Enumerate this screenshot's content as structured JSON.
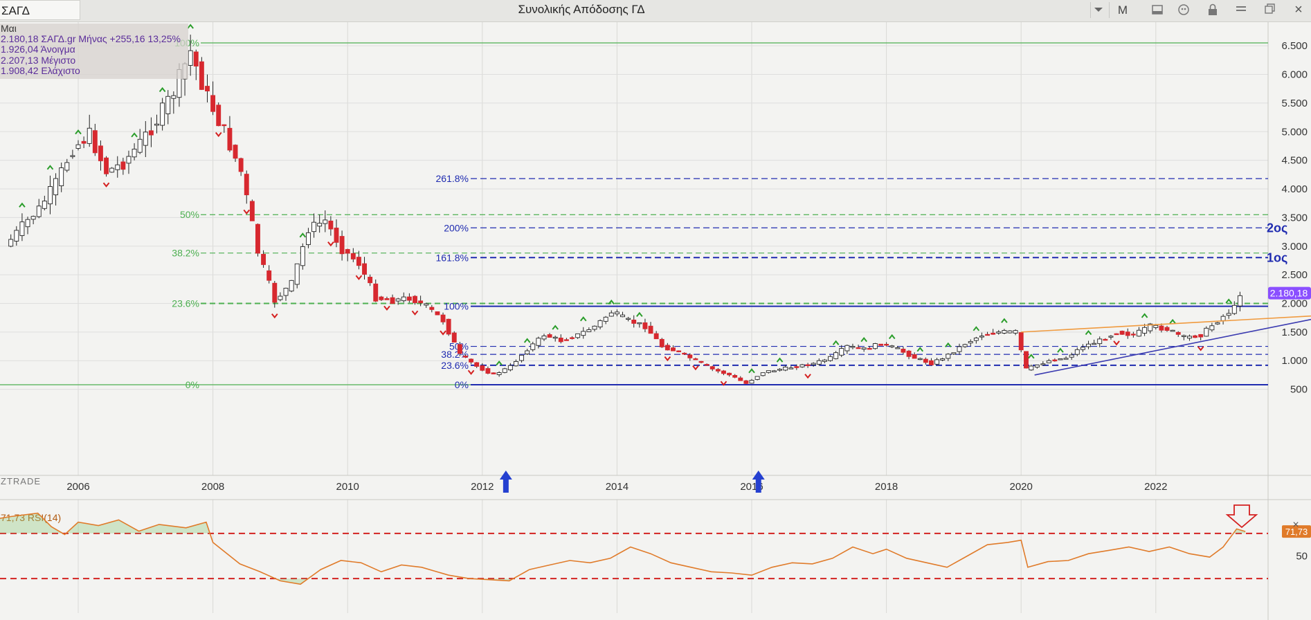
{
  "toolbar": {
    "symbol": "ΣΑΓΔ",
    "title": "Συνολικής Απόδοσης ΓΔ",
    "period": "M",
    "icons": [
      "chevron-down-icon",
      "layout-icon",
      "quote-icon",
      "lock-icon",
      "menu-icon",
      "restore-icon",
      "close-icon"
    ],
    "close_label": "×"
  },
  "info": {
    "period_label": "Μαι",
    "close_line": "2.180,18 ΣΑΓΔ.gr Μήνας +255,16 13,25%",
    "open_line": "1.926,04 Άνοιγμα",
    "high_line": "2.207,13 Μέγιστο",
    "low_line": "1.908,42 Ελάχιστο"
  },
  "watermark": "ZTRADE",
  "colors": {
    "up_candle": "#ffffff",
    "down_candle": "#d7282f",
    "fib_old": "#4caf50",
    "fib_new": "#1f2bb0",
    "rsi_line": "#e07b2a",
    "rsi_bound": "#d42020",
    "trend_orange": "#f09a3e",
    "trend_blue": "#3a3ab0",
    "last_price": "#8a4fff"
  },
  "annotations": {
    "target_2": "2ος",
    "target_1": "1ος"
  },
  "chart_data": [
    {
      "type": "candlestick",
      "period": "monthly",
      "x_ticks": [
        "2006",
        "2008",
        "2010",
        "2012",
        "2014",
        "2016",
        "2018",
        "2020",
        "2022"
      ],
      "y_ticks": [
        "6.500",
        "6.000",
        "5.500",
        "5.000",
        "4.500",
        "4.000",
        "3.500",
        "3.000",
        "2.500",
        "2.000",
        "1.500",
        "1.000",
        "500"
      ],
      "ylim": [
        430,
        6950
      ],
      "last_price_label": "2.180,18",
      "last_price": 2180.18,
      "series_approx_close": [
        [
          2005.0,
          3000
        ],
        [
          2005.25,
          3350
        ],
        [
          2005.5,
          3650
        ],
        [
          2005.75,
          4100
        ],
        [
          2006.0,
          4700
        ],
        [
          2006.25,
          4950
        ],
        [
          2006.5,
          4300
        ],
        [
          2006.75,
          4450
        ],
        [
          2007.0,
          4800
        ],
        [
          2007.25,
          5200
        ],
        [
          2007.5,
          5700
        ],
        [
          2007.75,
          6400
        ],
        [
          2008.0,
          5600
        ],
        [
          2008.25,
          5000
        ],
        [
          2008.5,
          4300
        ],
        [
          2008.75,
          2900
        ],
        [
          2009.0,
          2050
        ],
        [
          2009.25,
          2350
        ],
        [
          2009.5,
          3300
        ],
        [
          2009.75,
          3450
        ],
        [
          2010.0,
          2950
        ],
        [
          2010.25,
          2700
        ],
        [
          2010.5,
          2100
        ],
        [
          2010.75,
          2050
        ],
        [
          2011.0,
          2100
        ],
        [
          2011.25,
          1950
        ],
        [
          2011.5,
          1700
        ],
        [
          2011.75,
          1100
        ],
        [
          2012.0,
          900
        ],
        [
          2012.25,
          750
        ],
        [
          2012.5,
          900
        ],
        [
          2012.75,
          1200
        ],
        [
          2013.0,
          1450
        ],
        [
          2013.25,
          1350
        ],
        [
          2013.5,
          1450
        ],
        [
          2013.75,
          1600
        ],
        [
          2014.0,
          1850
        ],
        [
          2014.25,
          1700
        ],
        [
          2014.5,
          1600
        ],
        [
          2014.75,
          1250
        ],
        [
          2015.0,
          1150
        ],
        [
          2015.25,
          1000
        ],
        [
          2015.5,
          850
        ],
        [
          2015.75,
          750
        ],
        [
          2016.0,
          600
        ],
        [
          2016.25,
          800
        ],
        [
          2016.5,
          850
        ],
        [
          2016.75,
          900
        ],
        [
          2017.0,
          950
        ],
        [
          2017.25,
          1050
        ],
        [
          2017.5,
          1250
        ],
        [
          2017.75,
          1200
        ],
        [
          2018.0,
          1300
        ],
        [
          2018.25,
          1200
        ],
        [
          2018.5,
          1050
        ],
        [
          2018.75,
          950
        ],
        [
          2019.0,
          1100
        ],
        [
          2019.25,
          1300
        ],
        [
          2019.5,
          1450
        ],
        [
          2019.75,
          1500
        ],
        [
          2020.0,
          1500
        ],
        [
          2020.15,
          850
        ],
        [
          2020.5,
          1000
        ],
        [
          2020.75,
          1050
        ],
        [
          2021.0,
          1250
        ],
        [
          2021.25,
          1350
        ],
        [
          2021.5,
          1500
        ],
        [
          2021.75,
          1450
        ],
        [
          2022.0,
          1600
        ],
        [
          2022.25,
          1550
        ],
        [
          2022.5,
          1400
        ],
        [
          2022.75,
          1450
        ],
        [
          2023.0,
          1700
        ],
        [
          2023.25,
          1926
        ],
        [
          2023.33,
          2180
        ]
      ],
      "fibonacci_2007_2012": [
        {
          "label": "100%",
          "value": 6550
        },
        {
          "label": "50%",
          "value": 3550
        },
        {
          "label": "38.2%",
          "value": 2880
        },
        {
          "label": "23.6%",
          "value": 2000
        },
        {
          "label": "0%",
          "value": 580
        }
      ],
      "fibonacci_2014_2016": [
        {
          "label": "261.8%",
          "value": 4180
        },
        {
          "label": "200%",
          "value": 3320
        },
        {
          "label": "161.8%",
          "value": 2800
        },
        {
          "label": "100%",
          "value": 1950
        },
        {
          "label": "50%",
          "value": 1250
        },
        {
          "label": "38.2%",
          "value": 1110
        },
        {
          "label": "23.6%",
          "value": 920
        },
        {
          "label": "0%",
          "value": 580
        }
      ]
    },
    {
      "type": "line",
      "name": "71,73 RSI(14)",
      "value_label": "71,73",
      "y_ticks": [
        "50"
      ],
      "bounds": [
        70,
        30
      ],
      "series": [
        [
          2004.0,
          72
        ],
        [
          2004.5,
          80
        ],
        [
          2005.0,
          85
        ],
        [
          2005.4,
          88
        ],
        [
          2005.6,
          76
        ],
        [
          2005.8,
          69
        ],
        [
          2006.0,
          80
        ],
        [
          2006.3,
          77
        ],
        [
          2006.6,
          82
        ],
        [
          2006.9,
          72
        ],
        [
          2007.2,
          78
        ],
        [
          2007.6,
          75
        ],
        [
          2007.9,
          80
        ],
        [
          2008.0,
          62
        ],
        [
          2008.4,
          43
        ],
        [
          2008.7,
          36
        ],
        [
          2009.0,
          28
        ],
        [
          2009.3,
          25
        ],
        [
          2009.6,
          38
        ],
        [
          2009.9,
          46
        ],
        [
          2010.2,
          44
        ],
        [
          2010.5,
          36
        ],
        [
          2010.8,
          42
        ],
        [
          2011.1,
          40
        ],
        [
          2011.5,
          33
        ],
        [
          2011.8,
          30
        ],
        [
          2012.1,
          29
        ],
        [
          2012.4,
          28
        ],
        [
          2012.7,
          38
        ],
        [
          2013.0,
          42
        ],
        [
          2013.3,
          46
        ],
        [
          2013.6,
          44
        ],
        [
          2013.9,
          48
        ],
        [
          2014.2,
          58
        ],
        [
          2014.5,
          52
        ],
        [
          2014.8,
          44
        ],
        [
          2015.1,
          40
        ],
        [
          2015.4,
          36
        ],
        [
          2015.7,
          35
        ],
        [
          2016.0,
          33
        ],
        [
          2016.3,
          40
        ],
        [
          2016.6,
          44
        ],
        [
          2016.9,
          43
        ],
        [
          2017.2,
          48
        ],
        [
          2017.5,
          58
        ],
        [
          2017.8,
          52
        ],
        [
          2018.0,
          56
        ],
        [
          2018.3,
          48
        ],
        [
          2018.6,
          44
        ],
        [
          2018.9,
          40
        ],
        [
          2019.2,
          50
        ],
        [
          2019.5,
          60
        ],
        [
          2019.8,
          62
        ],
        [
          2020.0,
          64
        ],
        [
          2020.1,
          40
        ],
        [
          2020.4,
          45
        ],
        [
          2020.7,
          46
        ],
        [
          2021.0,
          52
        ],
        [
          2021.3,
          55
        ],
        [
          2021.6,
          58
        ],
        [
          2021.9,
          54
        ],
        [
          2022.2,
          58
        ],
        [
          2022.5,
          52
        ],
        [
          2022.8,
          49
        ],
        [
          2023.0,
          58
        ],
        [
          2023.2,
          74
        ],
        [
          2023.33,
          71.73
        ]
      ]
    }
  ]
}
